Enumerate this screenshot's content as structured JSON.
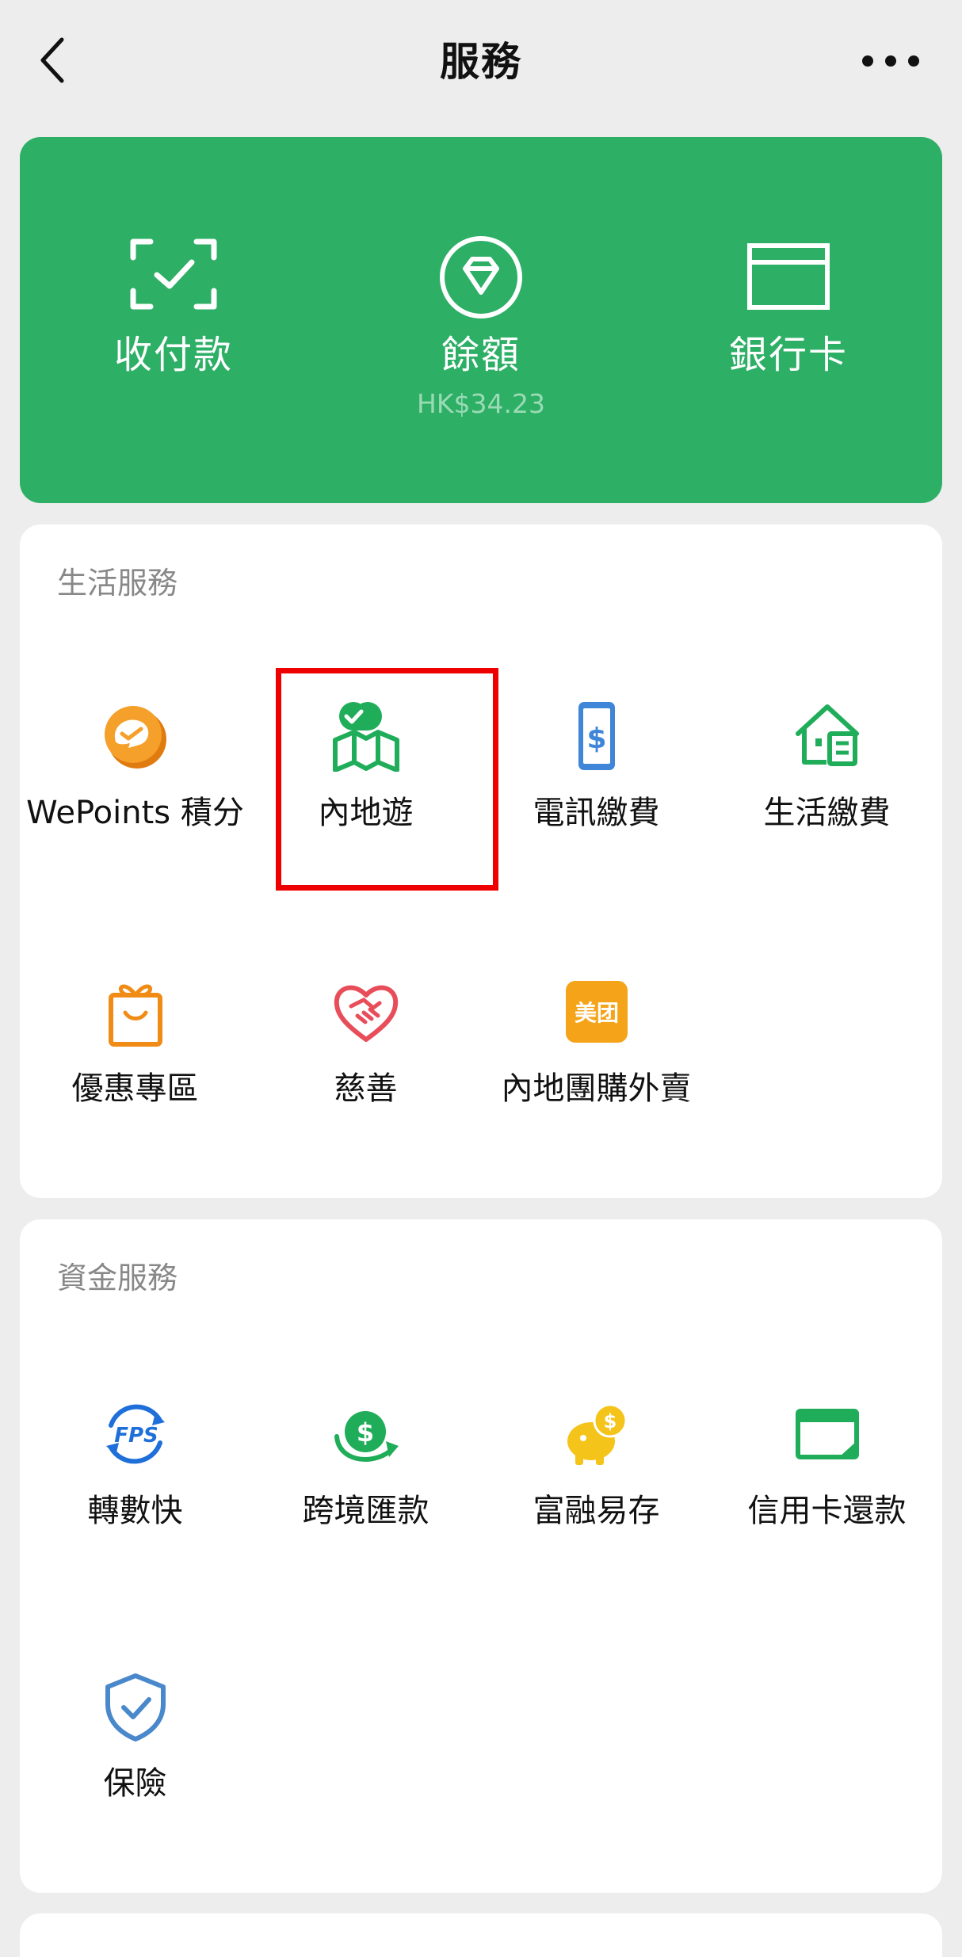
{
  "header": {
    "title": "服務"
  },
  "wallet": [
    {
      "label": "收付款",
      "sub": ""
    },
    {
      "label": "餘額",
      "sub": "HK$34.23"
    },
    {
      "label": "銀行卡",
      "sub": ""
    }
  ],
  "life": {
    "title": "生活服務",
    "items": [
      {
        "label": "WePoints 積分",
        "icon": "wepoints-icon"
      },
      {
        "label": "內地遊",
        "icon": "map-check-icon"
      },
      {
        "label": "電訊繳費",
        "icon": "phone-dollar-icon"
      },
      {
        "label": "生活繳費",
        "icon": "house-bill-icon"
      },
      {
        "label": "優惠專區",
        "icon": "gift-bag-icon"
      },
      {
        "label": "慈善",
        "icon": "heart-handshake-icon"
      },
      {
        "label": "內地團購外賣",
        "icon": "meituan-icon",
        "badge": "美团"
      }
    ]
  },
  "fund": {
    "title": "資金服務",
    "items": [
      {
        "label": "轉數快",
        "icon": "fps-icon",
        "badge": "FPS"
      },
      {
        "label": "跨境匯款",
        "icon": "cross-border-icon"
      },
      {
        "label": "富融易存",
        "icon": "piggy-bank-icon"
      },
      {
        "label": "信用卡還款",
        "icon": "credit-card-icon"
      },
      {
        "label": "保險",
        "icon": "shield-check-icon"
      }
    ]
  },
  "colors": {
    "brand_green": "#2daf66",
    "orange": "#f08c16",
    "blue": "#3f86d8",
    "red": "#e84d5a",
    "yellow": "#f5c41a",
    "highlight": "#ee0000"
  }
}
